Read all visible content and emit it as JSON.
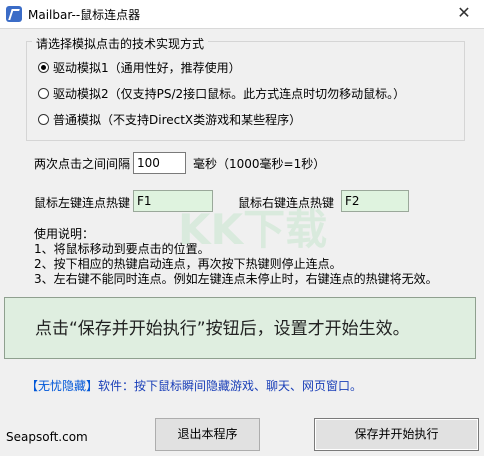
{
  "window": {
    "title": "Mailbar--鼠标连点器",
    "close_label": "✕"
  },
  "method_group": {
    "title": "请选择模拟点击的技术实现方式",
    "options": [
      {
        "label": "驱动模拟1（通用性好，推荐使用）",
        "checked": true
      },
      {
        "label": "驱动模拟2（仅支持PS/2接口鼠标。此方式连点时切勿移动鼠标。）",
        "checked": false
      },
      {
        "label": "普通模拟（不支持DirectX类游戏和某些程序）",
        "checked": false
      }
    ]
  },
  "interval": {
    "label": "两次点击之间间隔",
    "value": "100",
    "unit": "毫秒（1000毫秒=1秒）"
  },
  "hotkeys": {
    "left_label": "鼠标左键连点热键",
    "left_value": "F1",
    "right_label": "鼠标右键连点热键",
    "right_value": "F2"
  },
  "instructions": {
    "heading": "使用说明：",
    "lines": [
      "1、将鼠标移动到要点击的位置。",
      "2、按下相应的热键启动连点，再次按下热键则停止连点。",
      "3、左右键不能同时连点。例如左键连点未停止时，右键连点的热键将无效。"
    ]
  },
  "notice": {
    "text": "点击“保存并开始执行”按钮后，设置才开始生效。"
  },
  "promo": {
    "brand": "【无忧隐藏】",
    "text": "软件：按下鼠标瞬间隐藏游戏、聊天、网页窗口。"
  },
  "footer": {
    "site": "Seapsoft.com"
  },
  "buttons": {
    "exit": "退出本程序",
    "save_start": "保存并开始执行"
  },
  "watermark": "KK下载",
  "colors": {
    "hotkey_bg": "#dff3df",
    "notice_bg": "#dfeee0",
    "promo": "#1a3fb8"
  }
}
